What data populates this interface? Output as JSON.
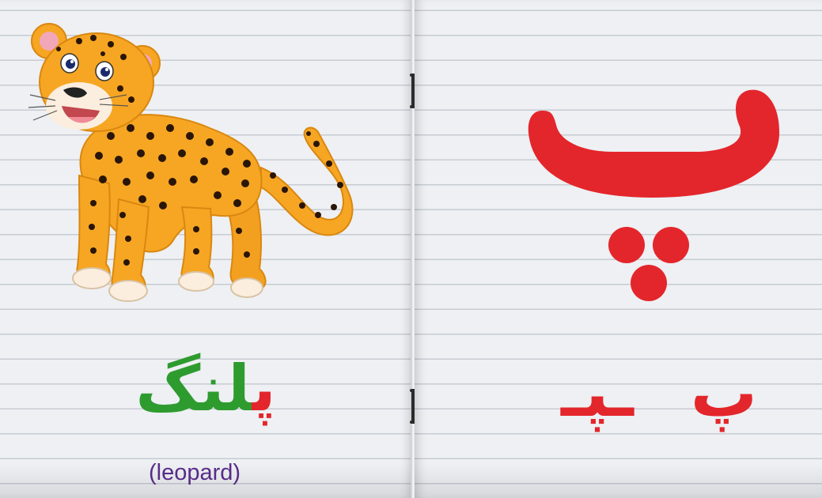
{
  "left_page": {
    "image": {
      "icon": "leopard-illustration"
    },
    "word": {
      "first_letter": "پ",
      "rest": "لنگ"
    },
    "translation": "(leopard)"
  },
  "right_page": {
    "letter": "پ",
    "letter_forms": {
      "isolated": "پ",
      "medial": "ـپـ"
    }
  },
  "colors": {
    "letter_red": "#e3262b",
    "word_green": "#2e9b2f",
    "translation_purple": "#5a2d8c",
    "leopard_orange": "#f6a623",
    "spot_brown": "#2a1608"
  }
}
